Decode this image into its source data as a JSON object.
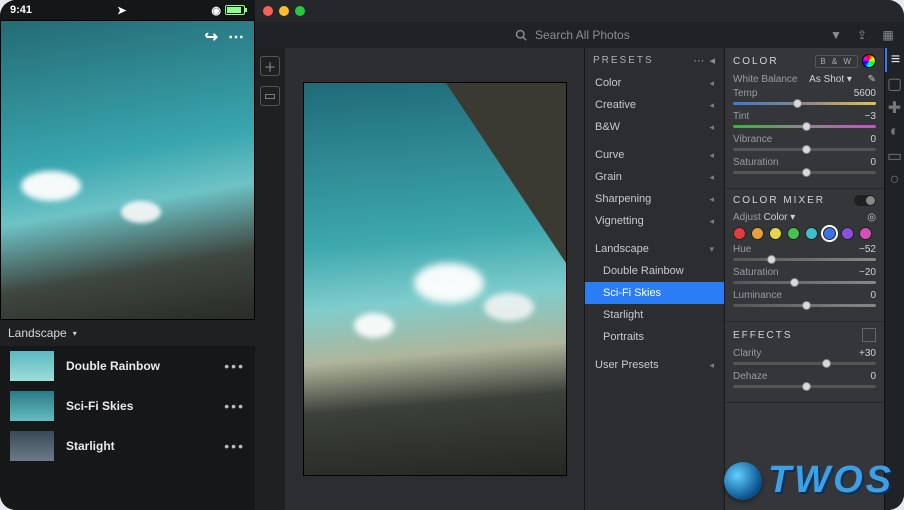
{
  "mobile": {
    "time": "9:41",
    "preset_group": "Landscape",
    "items": [
      {
        "label": "Double Rainbow"
      },
      {
        "label": "Sci-Fi Skies"
      },
      {
        "label": "Starlight"
      }
    ]
  },
  "topbar": {
    "search_placeholder": "Search All Photos"
  },
  "presets_panel": {
    "title": "PRESETS",
    "groups1": [
      "Color",
      "Creative",
      "B&W"
    ],
    "groups2": [
      "Curve",
      "Grain",
      "Sharpening",
      "Vignetting"
    ],
    "landscape_label": "Landscape",
    "landscape_items": [
      "Double Rainbow",
      "Sci-Fi Skies",
      "Starlight",
      "Portraits"
    ],
    "active": "Sci-Fi Skies",
    "user_presets": "User Presets"
  },
  "color": {
    "title": "COLOR",
    "bw": "B & W",
    "wb_label": "White Balance",
    "wb_value": "As Shot",
    "temp_label": "Temp",
    "temp_value": "5600",
    "tint_label": "Tint",
    "tint_value": "−3",
    "vib_label": "Vibrance",
    "vib_value": "0",
    "sat_label": "Saturation",
    "sat_value": "0"
  },
  "mixer": {
    "title": "COLOR MIXER",
    "adjust_label": "Adjust",
    "adjust_value": "Color",
    "swatches": [
      "#e23b3b",
      "#e8a13a",
      "#e6d74a",
      "#49c24b",
      "#3ec1c8",
      "#3a72e8",
      "#8b4fe0",
      "#d84fb8"
    ],
    "hue_label": "Hue",
    "hue_value": "−52",
    "sat_label": "Saturation",
    "sat_value": "−20",
    "lum_label": "Luminance",
    "lum_value": "0"
  },
  "effects": {
    "title": "EFFECTS",
    "clarity_label": "Clarity",
    "clarity_value": "+30",
    "dehaze_label": "Dehaze",
    "dehaze_value": "0"
  },
  "watermark": "TWOS"
}
